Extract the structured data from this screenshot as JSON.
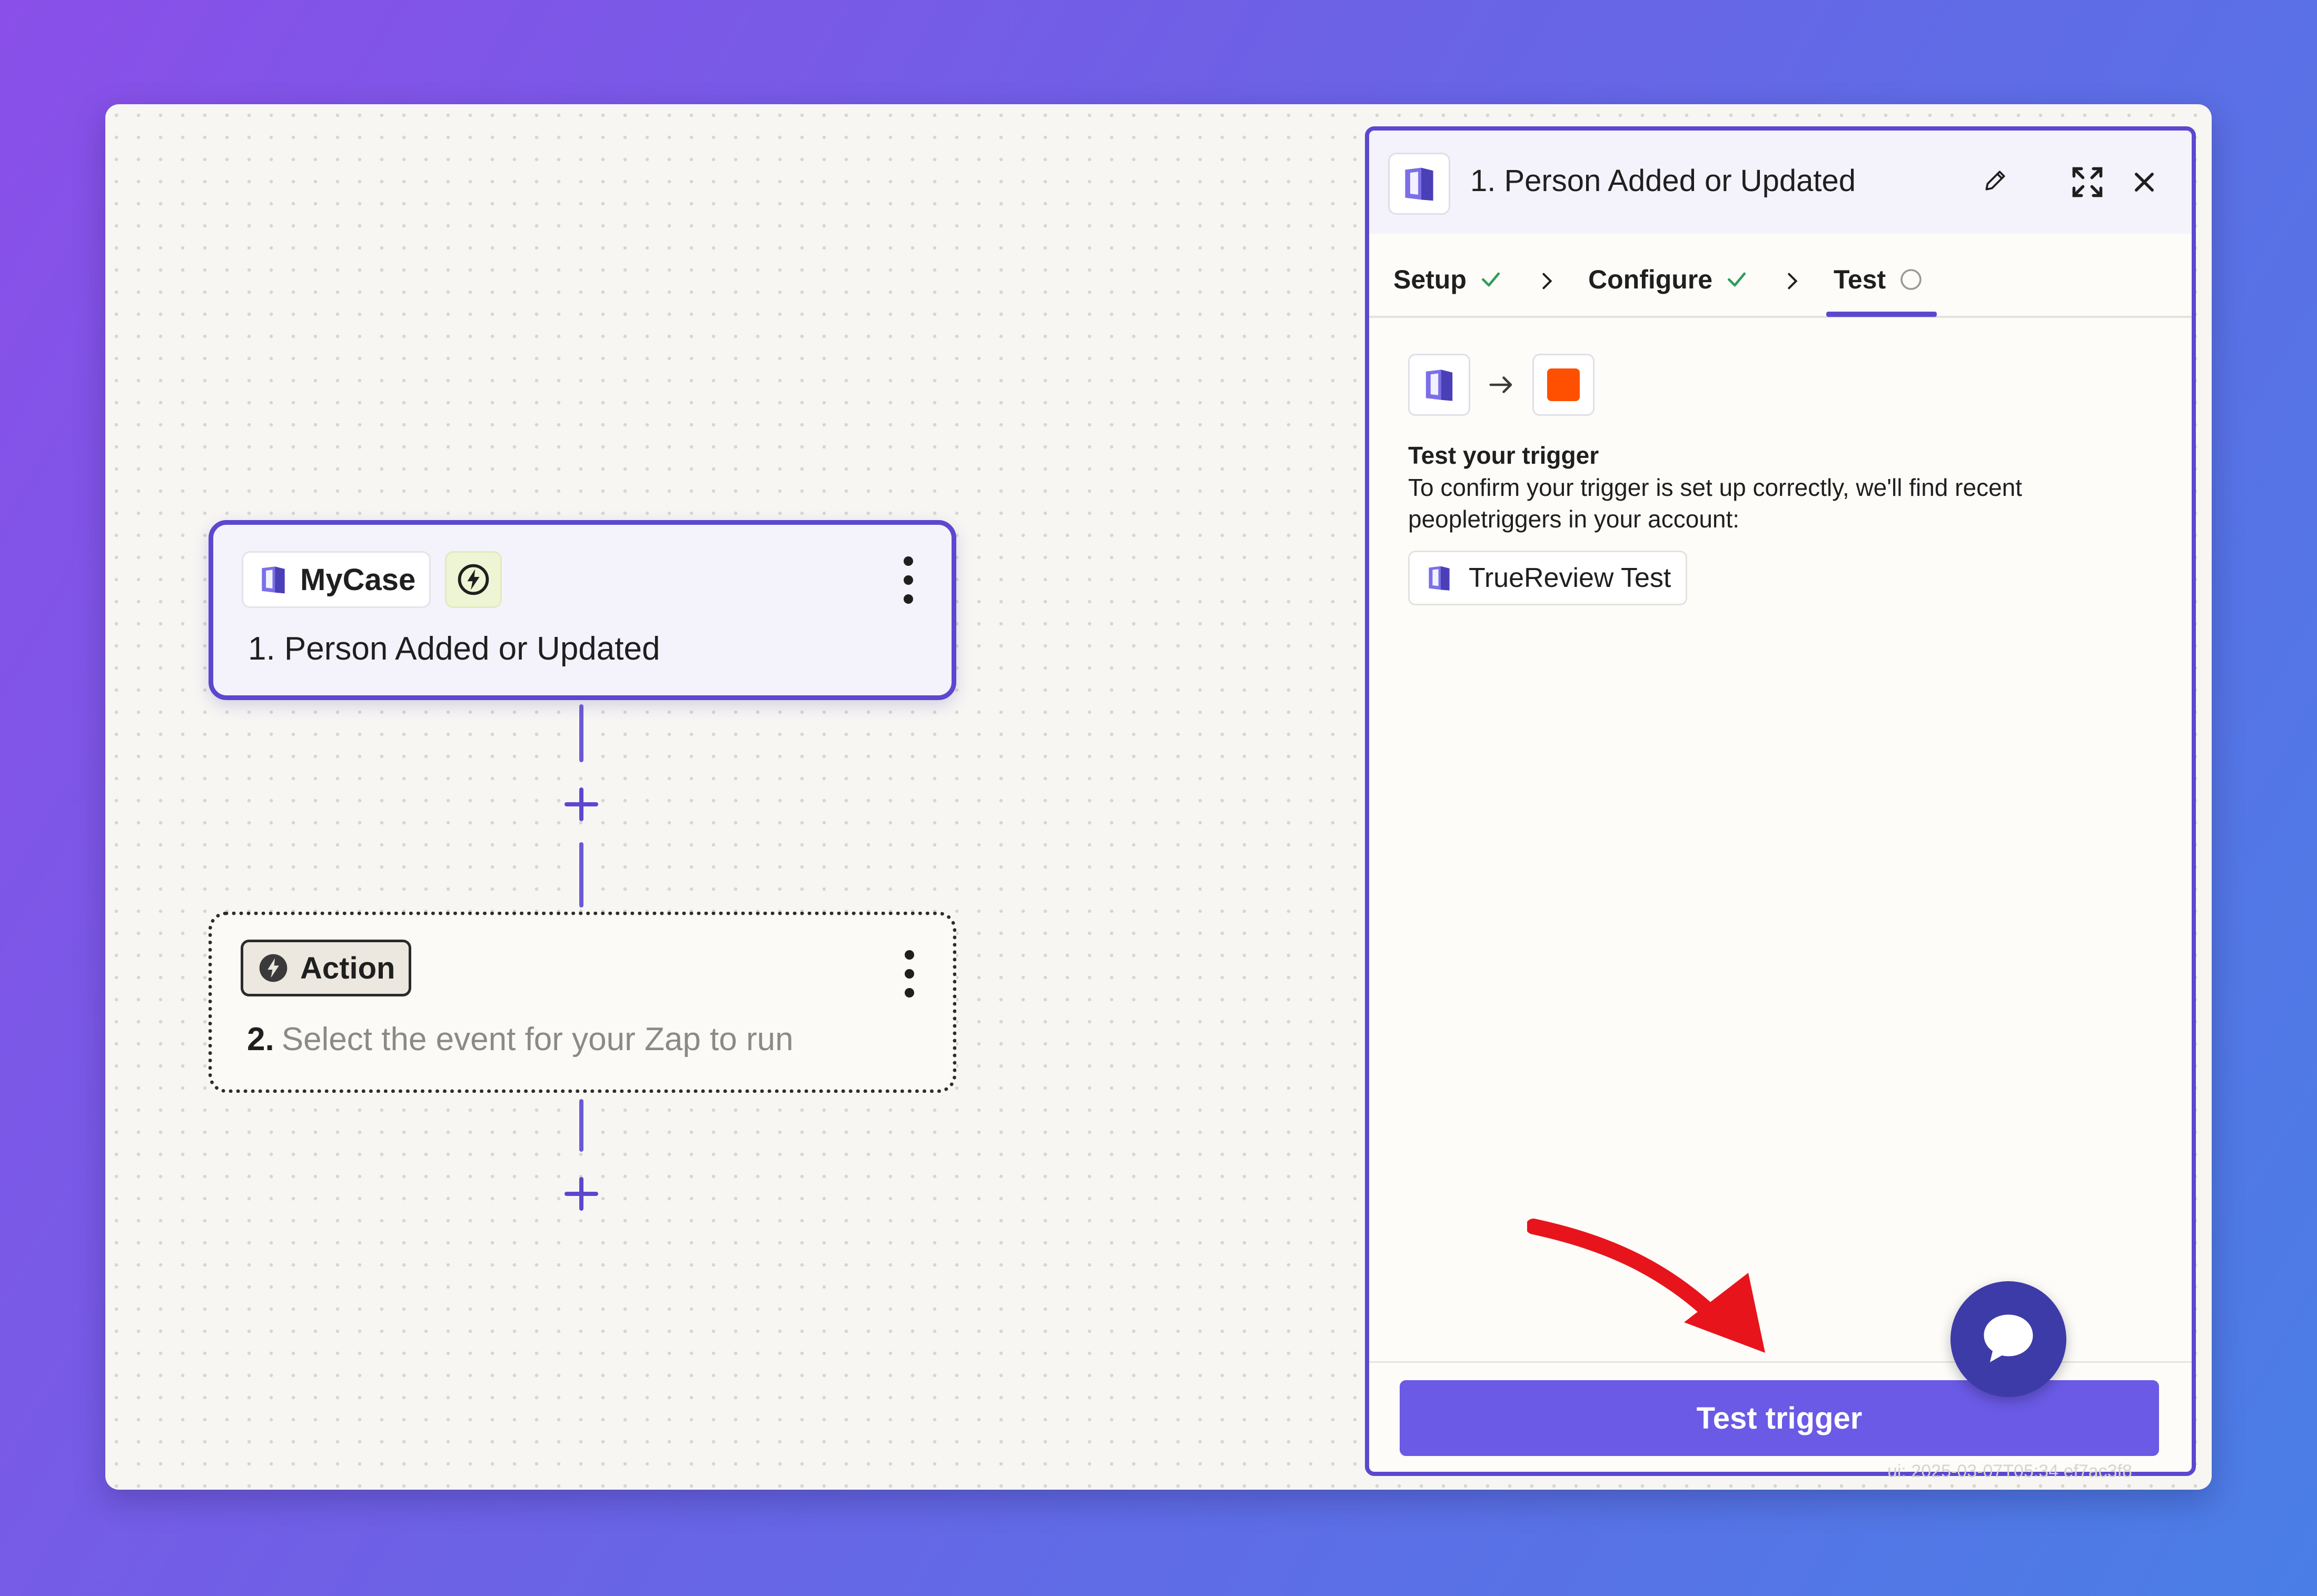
{
  "trigger_step": {
    "app_name": "MyCase",
    "title": "1. Person Added or Updated",
    "app_icon": "mycase-book-icon",
    "badge_icon": "lightning-bolt-icon"
  },
  "action_step": {
    "label": "Action",
    "number": "2.",
    "placeholder": "Select the event for your Zap to run"
  },
  "panel": {
    "title": "1. Person Added or Updated",
    "tabs": [
      {
        "label": "Setup",
        "status": "complete"
      },
      {
        "label": "Configure",
        "status": "complete"
      },
      {
        "label": "Test",
        "status": "pending"
      }
    ],
    "test_heading": "Test your trigger",
    "test_description": "To confirm your trigger is set up correctly, we'll find recent peopletriggers in your account:",
    "account_name": "TrueReview Test",
    "test_button": "Test trigger"
  },
  "footer": {
    "version": "ui: 2025-03-07T05:34 ef7ac3f8"
  },
  "colors": {
    "accent": "#5b48cf",
    "button": "#6a5ae6",
    "zapier_orange": "#ff4f00",
    "success_check": "#2e9e5b",
    "annotation_arrow": "#e8141c"
  }
}
